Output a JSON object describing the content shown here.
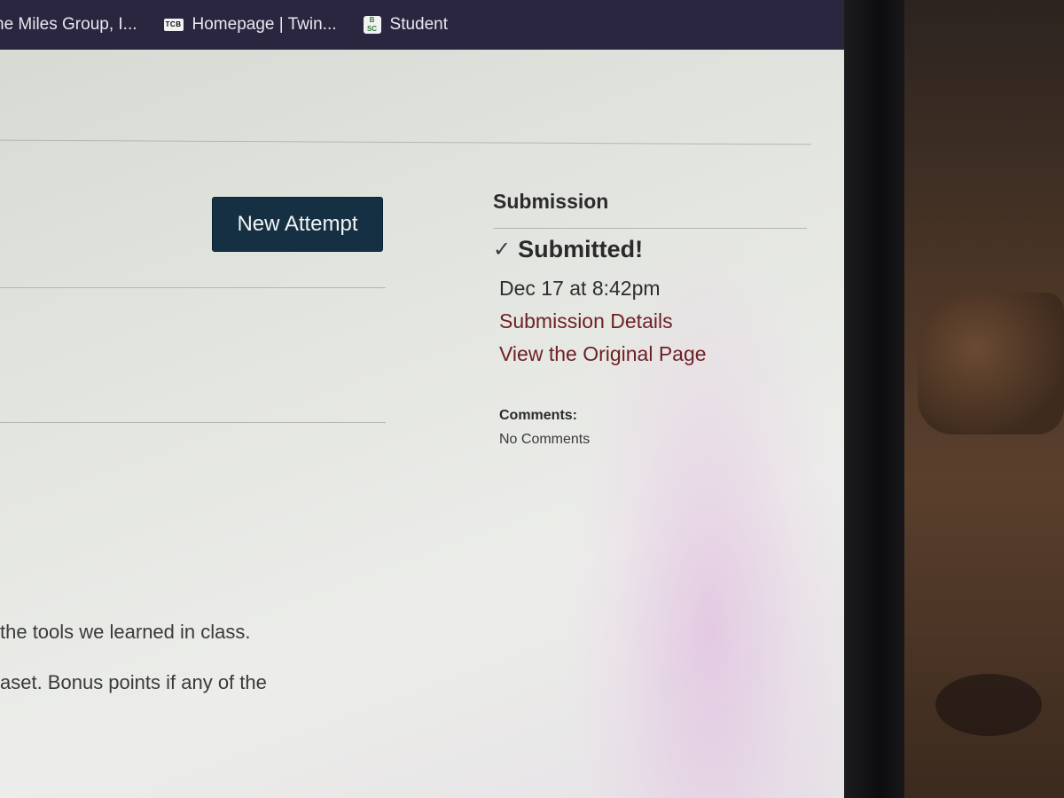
{
  "bookmarks": {
    "items": [
      {
        "label": "he Miles Group, I...",
        "icon": "none"
      },
      {
        "label": "Homepage | Twin...",
        "icon": "tcb-icon",
        "icon_text": "TCB"
      },
      {
        "label": "Student",
        "icon": "bsc-icon",
        "icon_text": "B\nSC"
      }
    ]
  },
  "assignment": {
    "new_attempt_label": "New Attempt",
    "body_lines": [
      "the tools we learned in class.",
      "aset. Bonus points if any of the"
    ]
  },
  "submission": {
    "heading": "Submission",
    "status": "Submitted!",
    "status_icon": "checkmark-icon",
    "date": "Dec 17 at 8:42pm",
    "details_link": "Submission Details",
    "original_page_link": "View the Original Page",
    "comments_label": "Comments:",
    "comments_value": "No Comments"
  },
  "colors": {
    "bookmarks_bar": "#2a2640",
    "button_bg": "#163043",
    "link": "#6e1f24"
  }
}
